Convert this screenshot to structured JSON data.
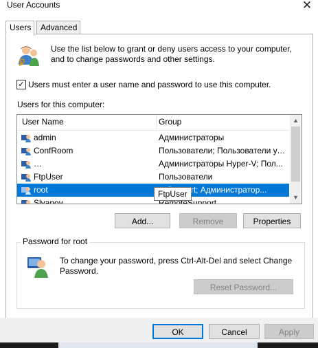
{
  "window": {
    "title": "User Accounts",
    "close_symbol": "✕"
  },
  "tabs": [
    {
      "label": "Users",
      "active": true
    },
    {
      "label": "Advanced",
      "active": false
    }
  ],
  "intro_text": "Use the list below to grant or deny users access to your computer, and to change passwords and other settings.",
  "require_login": {
    "checked": true,
    "label": "Users must enter a user name and password to use this computer."
  },
  "users_section_label": "Users for this computer:",
  "table": {
    "columns": [
      "User Name",
      "Group"
    ],
    "rows": [
      {
        "name": "admin",
        "group": "Администраторы",
        "selected": false
      },
      {
        "name": "ConfRoom",
        "group": "Пользователи; Пользователи уд...",
        "selected": false
      },
      {
        "name": "…",
        "group": "Администраторы Hyper-V; Пол...",
        "selected": false
      },
      {
        "name": "FtpUser",
        "group": "Пользователи",
        "selected": false
      },
      {
        "name": "root",
        "group": "…Support; Администратор...",
        "selected": true
      },
      {
        "name": "Slyanov",
        "group": "RemoteSupport",
        "selected": false
      }
    ],
    "tooltip": "FtpUser"
  },
  "list_buttons": {
    "add": "Add...",
    "remove": "Remove",
    "properties": "Properties"
  },
  "password_group": {
    "title": "Password for root",
    "text": "To change your password, press Ctrl-Alt-Del and select Change Password.",
    "reset_button": "Reset Password..."
  },
  "footer_buttons": {
    "ok": "OK",
    "cancel": "Cancel",
    "apply": "Apply"
  },
  "colors": {
    "selection": "#0078d7",
    "disabled_text": "#838383",
    "button_face": "#e1e1e1"
  },
  "icons": [
    "users-icon",
    "user-icon",
    "password-user-icon",
    "close-icon",
    "scroll-up-icon",
    "scroll-down-icon",
    "checkbox-check-icon"
  ]
}
